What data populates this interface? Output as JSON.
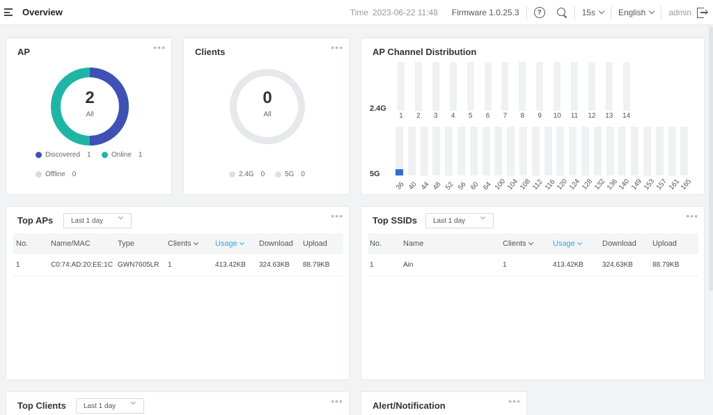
{
  "header": {
    "title": "Overview",
    "time_label": "Time",
    "time_value": "2023-06-22 11:48",
    "firmware_label": "Firmware 1.0.25.3",
    "help_icon": "?",
    "refresh_interval": "15s",
    "language": "English",
    "user": "admin"
  },
  "ap_card": {
    "title": "AP",
    "total": "2",
    "total_label": "All",
    "legend": [
      {
        "label": "Discovered",
        "value": "1",
        "color": "#3f51b5"
      },
      {
        "label": "Online",
        "value": "1",
        "color": "#1fb5a6"
      },
      {
        "label": "Offline",
        "value": "0",
        "color": "#d9d9d9"
      }
    ]
  },
  "clients_card": {
    "title": "Clients",
    "total": "0",
    "total_label": "All",
    "legend": [
      {
        "label": "2.4G",
        "value": "0",
        "color": "#dddfe3"
      },
      {
        "label": "5G",
        "value": "0",
        "color": "#dddfe3"
      }
    ]
  },
  "channel_card": {
    "title": "AP Channel Distribution",
    "band_24_label": "2.4G",
    "band_5_label": "5G",
    "channels_24": [
      "1",
      "2",
      "3",
      "4",
      "5",
      "6",
      "7",
      "8",
      "9",
      "10",
      "11",
      "12",
      "13",
      "14"
    ],
    "channels_5": [
      "36",
      "40",
      "44",
      "48",
      "52",
      "56",
      "60",
      "64",
      "100",
      "104",
      "108",
      "112",
      "116",
      "120",
      "124",
      "128",
      "132",
      "136",
      "140",
      "149",
      "153",
      "157",
      "161",
      "165"
    ],
    "values_5": [
      0.13,
      0,
      0,
      0,
      0,
      0,
      0,
      0,
      0,
      0,
      0,
      0,
      0,
      0,
      0,
      0,
      0,
      0,
      0,
      0,
      0,
      0,
      0,
      0
    ],
    "accent": "#2f6fd0"
  },
  "top_aps": {
    "title": "Top APs",
    "range": "Last 1 day",
    "columns": [
      "No.",
      "Name/MAC",
      "Type",
      "Clients",
      "Usage",
      "Download",
      "Upload"
    ],
    "rows": [
      [
        "1",
        "C0:74:AD:20:EE:1C",
        "GWN7605LR",
        "1",
        "413.42KB",
        "324.63KB",
        "88.79KB"
      ]
    ]
  },
  "top_ssids": {
    "title": "Top SSIDs",
    "range": "Last 1 day",
    "columns": [
      "No.",
      "Name",
      "Clients",
      "Usage",
      "Download",
      "Upload"
    ],
    "rows": [
      [
        "1",
        "Ain",
        "1",
        "413.42KB",
        "324.63KB",
        "88.79KB"
      ]
    ]
  },
  "top_clients": {
    "title": "Top Clients",
    "range": "Last 1 day"
  },
  "alerts": {
    "title": "Alert/Notification"
  },
  "menu_dots": "•••"
}
